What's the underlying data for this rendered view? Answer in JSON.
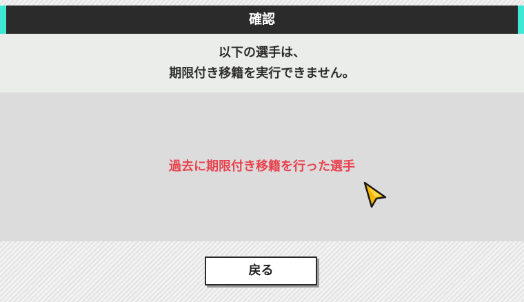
{
  "dialog": {
    "title": "確認",
    "message_line1": "以下の選手は、",
    "message_line2": "期限付き移籍を実行できません。",
    "reason": "過去に期限付き移籍を行った選手",
    "back_button_label": "戻る"
  },
  "colors": {
    "title_bar": "#2b2b2b",
    "accent": "#3ee8d4",
    "reason_text": "#e8414d",
    "cursor": "#f5b800"
  },
  "icons": {
    "cursor": "pointer-arrow-icon"
  }
}
